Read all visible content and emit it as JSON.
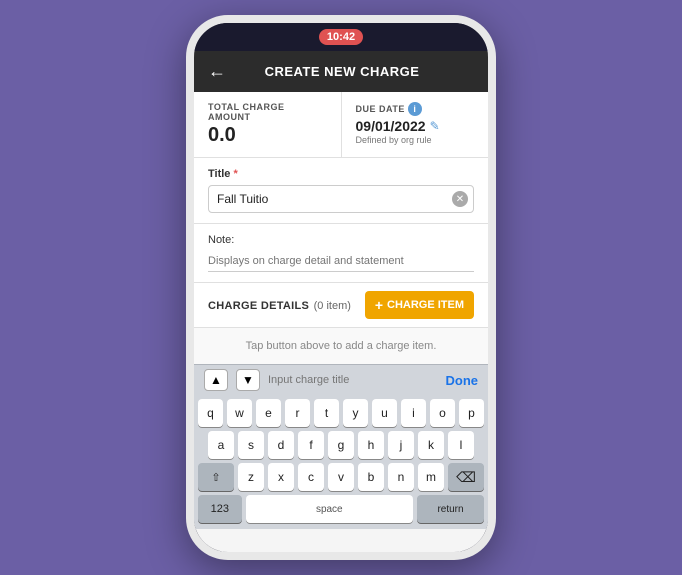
{
  "statusBar": {
    "time": "10:42"
  },
  "header": {
    "backLabel": "←",
    "title": "CREATE NEW CHARGE"
  },
  "summary": {
    "totalLabel": "TOTAL CHARGE AMOUNT",
    "totalValue": "0.0",
    "dueDateLabel": "DUE DATE",
    "dueDateValue": "09/01/2022",
    "orgRule": "Defined by org rule"
  },
  "form": {
    "titleLabel": "Title",
    "titleValue": "Fall Tuitio",
    "noteLabel": "Note:",
    "notePlaceholder": "Displays on charge detail and statement"
  },
  "chargeDetails": {
    "label": "CHARGE DETAILS",
    "itemCount": "(0 item)",
    "addButtonLabel": "+ CHARGE ITEM",
    "hintText": "Tap button above to add a charge item."
  },
  "keyboardToolbar": {
    "upArrow": "▲",
    "downArrow": "▼",
    "placeholder": "Input charge title",
    "doneLabel": "Done"
  },
  "keyboard": {
    "row1": [
      "q",
      "w",
      "e",
      "r",
      "t",
      "y",
      "u",
      "i",
      "o",
      "p"
    ],
    "row2": [
      "a",
      "s",
      "d",
      "f",
      "g",
      "h",
      "j",
      "k",
      "l"
    ],
    "row3": [
      "z",
      "x",
      "c",
      "v",
      "b",
      "n",
      "m"
    ],
    "spaceLabel": "space",
    "returnLabel": "return",
    "numLabel": "123",
    "deleteIcon": "⌫",
    "shiftIcon": "⇧"
  },
  "colors": {
    "accent": "#f0a500",
    "headerBg": "#2c2c2c",
    "infoBg": "#5b9bd5",
    "required": "#e05252"
  }
}
